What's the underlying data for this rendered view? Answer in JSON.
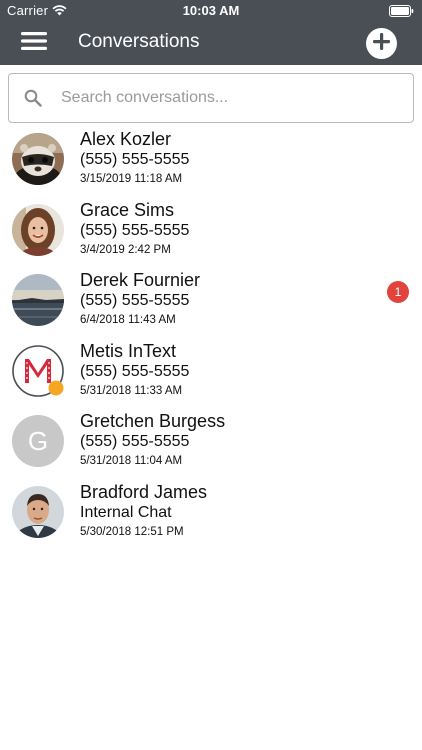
{
  "status_bar": {
    "carrier": "Carrier",
    "time": "10:03 AM"
  },
  "header": {
    "title": "Conversations"
  },
  "search": {
    "placeholder": "Search conversations..."
  },
  "conversations": [
    {
      "name": "Alex Kozler",
      "subtitle": "(555) 555-5555",
      "date": "3/15/2019 11:18 AM",
      "avatar": "ferret-photo"
    },
    {
      "name": "Grace Sims",
      "subtitle": "(555) 555-5555",
      "date": "3/4/2019 2:42 PM",
      "avatar": "woman-photo"
    },
    {
      "name": "Derek Fournier",
      "subtitle": "(555) 555-5555",
      "date": "6/4/2018 11:43 AM",
      "avatar": "lake-photo",
      "unread": "1"
    },
    {
      "name": "Metis InText",
      "subtitle": "(555) 555-5555",
      "date": "5/31/2018 11:33 AM",
      "avatar": "metis-logo"
    },
    {
      "name": "Gretchen Burgess",
      "subtitle": "(555) 555-5555",
      "date": "5/31/2018 11:04 AM",
      "avatar": "initial",
      "initial": "G"
    },
    {
      "name": "Bradford James",
      "subtitle": "Internal Chat",
      "date": "5/30/2018 12:51 PM",
      "avatar": "man-photo"
    }
  ],
  "colors": {
    "header_bg": "#4a4e55",
    "badge": "#e0443c",
    "metis_red": "#d6283a",
    "presence": "#f5a623",
    "initial_avatar": "#c8c8c8"
  }
}
